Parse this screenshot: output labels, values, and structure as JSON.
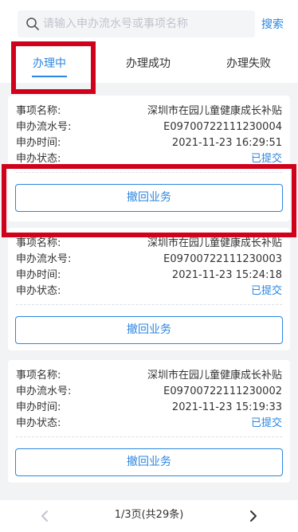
{
  "search": {
    "placeholder": "请输入申办流水号或事项名称",
    "button_label": "搜索"
  },
  "tabs": [
    {
      "label": "办理中",
      "active": true
    },
    {
      "label": "办理成功",
      "active": false
    },
    {
      "label": "办理失败",
      "active": false
    }
  ],
  "field_labels": {
    "name": "事项名称:",
    "serial": "申办流水号:",
    "time": "申办时间:",
    "status": "申办状态:"
  },
  "records": [
    {
      "name": "深圳市在园儿童健康成长补贴",
      "serial": "E09700722111230004",
      "time": "2021-11-23 16:29:51",
      "status": "已提交",
      "action": "撤回业务"
    },
    {
      "name": "深圳市在园儿童健康成长补贴",
      "serial": "E09700722111230003",
      "time": "2021-11-23 15:24:18",
      "status": "已提交",
      "action": "撤回业务"
    },
    {
      "name": "深圳市在园儿童健康成长补贴",
      "serial": "E09700722111230002",
      "time": "2021-11-23 15:19:33",
      "status": "已提交",
      "action": "撤回业务"
    }
  ],
  "pagination": {
    "info": "1/3页(共29条)"
  },
  "colors": {
    "accent": "#2b86e0",
    "annotation": "#d0021b",
    "background": "#f2f3f5"
  },
  "icons": {
    "search": "search-icon",
    "prev": "chevron-left-icon",
    "next": "chevron-right-icon"
  }
}
